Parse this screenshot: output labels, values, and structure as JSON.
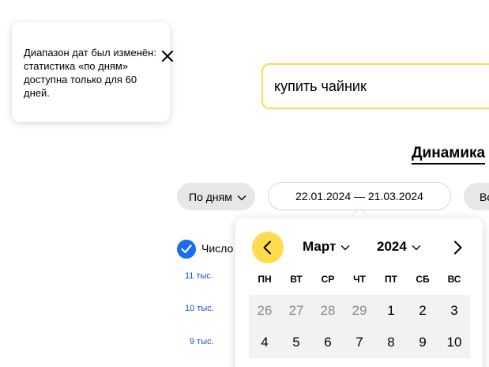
{
  "toast": {
    "text": "Диапазон дат был изменён: статистика «по дням» доступна только для 60 дней.",
    "close_icon": "close-icon"
  },
  "search": {
    "value": "купить чайник"
  },
  "heading": "Динамика",
  "filters": {
    "period": "По дням",
    "date_range": "22.01.2024 — 21.03.2024",
    "devices": "Во"
  },
  "legend": {
    "label": "Число",
    "checked": true,
    "color": "#1a6cf5"
  },
  "yaxis": {
    "ticks": [
      "11 тыс.",
      "10 тыс.",
      "9 тыс."
    ]
  },
  "calendar": {
    "month": "Март",
    "year": "2024",
    "weekdays": [
      "ПН",
      "ВТ",
      "СР",
      "ЧТ",
      "ПТ",
      "СБ",
      "ВС"
    ],
    "rows": [
      [
        "26",
        "27",
        "28",
        "29",
        "1",
        "2",
        "3"
      ],
      [
        "4",
        "5",
        "6",
        "7",
        "8",
        "9",
        "10"
      ]
    ],
    "outside_month": [
      [
        true,
        true,
        true,
        true,
        false,
        false,
        false
      ],
      [
        false,
        false,
        false,
        false,
        false,
        false,
        false
      ]
    ],
    "prev_icon": "chevron-left-icon",
    "next_icon": "chevron-right-icon"
  },
  "colors": {
    "accent_yellow": "#ffdb4d",
    "link_blue": "#1a4fd6",
    "checkbox_blue": "#1a6cf5",
    "chip_grey": "#e7e7e7",
    "cell_grey": "#f2f2f2"
  }
}
